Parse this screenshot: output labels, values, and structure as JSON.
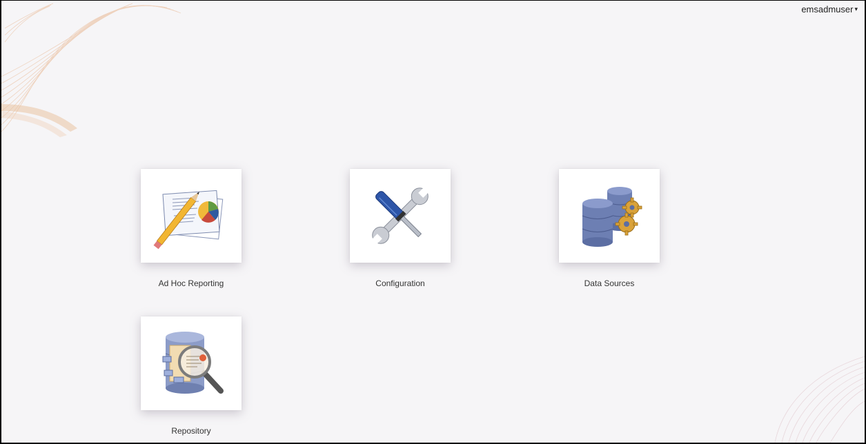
{
  "header": {
    "username": "emsadmuser",
    "menu_caret": "▾"
  },
  "tiles": [
    {
      "label": "Ad Hoc Reporting",
      "icon": "report-icon"
    },
    {
      "label": "Configuration",
      "icon": "tools-icon"
    },
    {
      "label": "Data Sources",
      "icon": "database-gear-icon"
    },
    {
      "label": "Repository",
      "icon": "repository-icon"
    }
  ],
  "colors": {
    "background": "#f6f5f7",
    "swirl": "#e8b690",
    "database_blue": "#6d7fb3",
    "gear_gold": "#d9a23a"
  }
}
